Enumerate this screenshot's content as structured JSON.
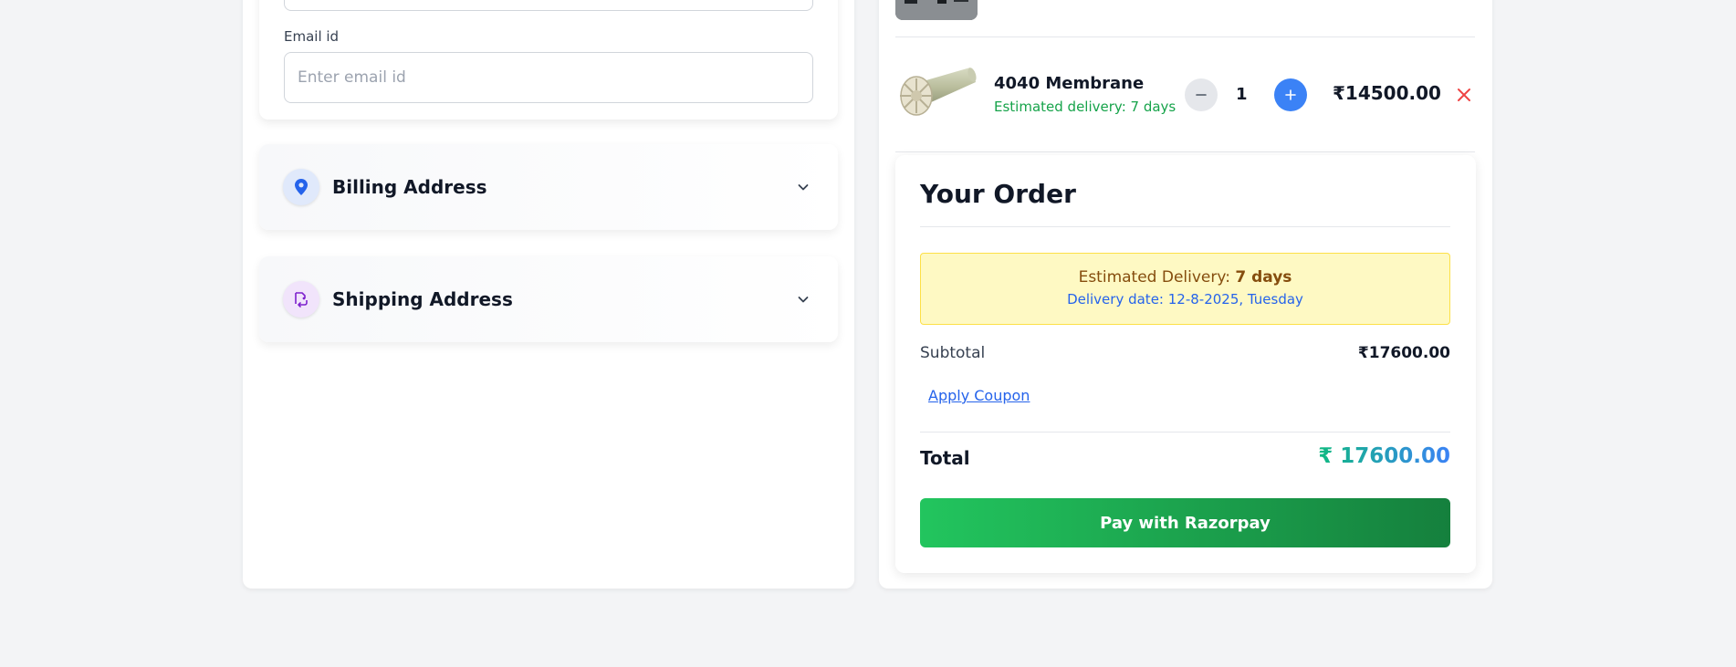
{
  "contact": {
    "email_label": "Email id",
    "email_placeholder": "Enter email id",
    "email_value": ""
  },
  "sections": {
    "billing": {
      "title": "Billing Address",
      "icon": "location-pin-icon"
    },
    "shipping": {
      "title": "Shipping Address",
      "icon": "shipping-icon"
    }
  },
  "cart": {
    "items": [
      {
        "name": "4040 Membrane",
        "delivery": "Estimated delivery: 7 days",
        "quantity": "1",
        "price": "₹14500.00"
      }
    ]
  },
  "order": {
    "title": "Your Order",
    "delivery_label": "Estimated Delivery:",
    "delivery_days": "7 days",
    "delivery_date": "Delivery date: 12-8-2025, Tuesday",
    "subtotal_label": "Subtotal",
    "subtotal_value": "₹17600.00",
    "coupon_label": "Apply Coupon",
    "total_label": "Total",
    "total_value": "₹ 17600.00",
    "pay_label": "Pay with Razorpay"
  },
  "colors": {
    "accent_blue": "#3b82f6",
    "success_green": "#16a34a",
    "remove_red": "#ef4444",
    "pay_gradient_start": "#22c55e",
    "pay_gradient_end": "#15803d"
  }
}
